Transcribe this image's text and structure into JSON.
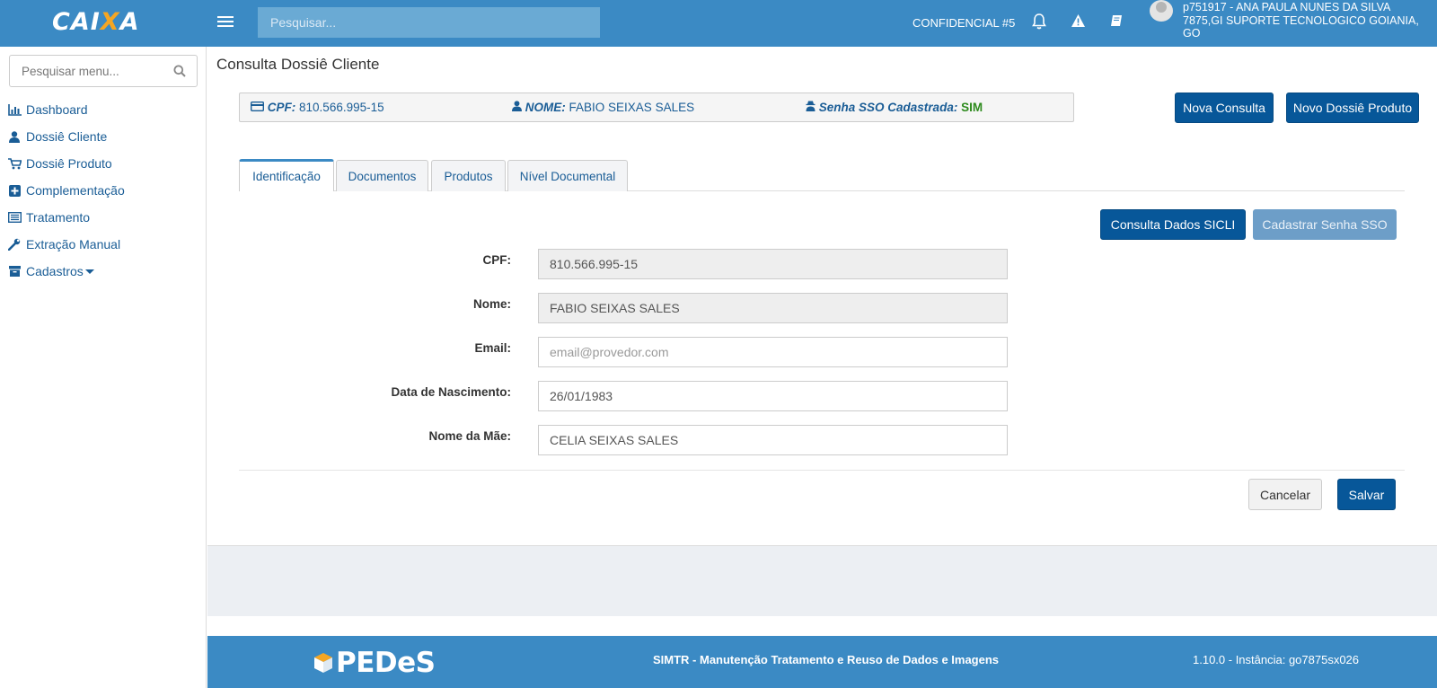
{
  "header": {
    "logo_text_pre": "CAI",
    "logo_text_x": "X",
    "logo_text_post": "A",
    "search_placeholder": "Pesquisar...",
    "confidencial": "CONFIDENCIAL #5",
    "user_line1": "p751917 - ANA PAULA NUNES DA SILVA",
    "user_line2": "7875,GI SUPORTE TECNOLOGICO GOIANIA, GO",
    "icons": [
      "menu-icon",
      "bell-icon",
      "warning-icon",
      "book-icon",
      "user-avatar"
    ]
  },
  "sidebar": {
    "search_placeholder": "Pesquisar menu...",
    "items": [
      {
        "label": "Dashboard",
        "icon": "bar-chart-icon"
      },
      {
        "label": "Dossiê Cliente",
        "icon": "user-icon"
      },
      {
        "label": "Dossiê Produto",
        "icon": "cart-icon"
      },
      {
        "label": "Complementação",
        "icon": "plus-square-icon"
      },
      {
        "label": "Tratamento",
        "icon": "list-icon"
      },
      {
        "label": "Extração Manual",
        "icon": "wrench-icon"
      },
      {
        "label": "Cadastros",
        "icon": "archive-icon"
      }
    ]
  },
  "page": {
    "title": "Consulta Dossiê Cliente",
    "info": {
      "cpf_label": "CPF:",
      "cpf_value": "810.566.995-15",
      "nome_label": "NOME:",
      "nome_value": "FABIO SEIXAS SALES",
      "senha_label": "Senha SSO Cadastrada:",
      "senha_value": "SIM"
    },
    "buttons": {
      "nova_consulta": "Nova Consulta",
      "novo_dossie_produto": "Novo Dossiê Produto",
      "consulta_sicli": "Consulta Dados SICLI",
      "cadastrar_senha": "Cadastrar Senha SSO",
      "cancelar": "Cancelar",
      "salvar": "Salvar"
    },
    "tabs": [
      {
        "label": "Identificação",
        "active": true
      },
      {
        "label": "Documentos",
        "active": false
      },
      {
        "label": "Produtos",
        "active": false
      },
      {
        "label": "Nível Documental",
        "active": false
      }
    ],
    "form": {
      "cpf_label": "CPF:",
      "cpf_value": "810.566.995-15",
      "nome_label": "Nome:",
      "nome_value": "FABIO SEIXAS SALES",
      "email_label": "Email:",
      "email_value": "",
      "email_placeholder": "email@provedor.com",
      "nascimento_label": "Data de Nascimento:",
      "nascimento_value": "26/01/1983",
      "mae_label": "Nome da Mãe:",
      "mae_value": "CELIA SEIXAS SALES"
    }
  },
  "footer": {
    "brand": "PEDeS",
    "title": "SIMTR - Manutenção Tratamento e Reuso de Dados e Imagens",
    "version": "1.10.0 - Instância: go7875sx026"
  },
  "colors": {
    "header_bg": "#3b8ac4",
    "primary_button": "#075799",
    "link": "#1a5d96",
    "sim_green": "#2e8b1e",
    "logo_accent": "#f5a623"
  }
}
